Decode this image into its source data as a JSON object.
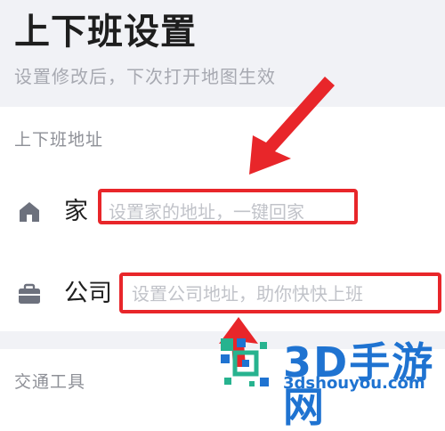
{
  "header": {
    "title": "上下班设置",
    "subtitle": "设置修改后，下次打开地图生效"
  },
  "sections": {
    "commute_label": "上下班地址",
    "transport_label": "交通工具"
  },
  "rows": {
    "home": {
      "label": "家",
      "placeholder": "设置家的地址，一键回家",
      "icon": "home-icon"
    },
    "company": {
      "label": "公司",
      "placeholder": "设置公司地址，助你快快上班",
      "icon": "briefcase-icon"
    }
  },
  "watermark": {
    "brand": "3D手游网",
    "url": "3dshouyou.com"
  },
  "colors": {
    "background": "#ffffff",
    "header_background": "#f1f2f6",
    "annotation_red": "#e8262a",
    "placeholder": "#c1c3c9",
    "icon_gray": "#6d717d",
    "watermark_blue": "#1f73d1",
    "watermark_green": "#27b38f"
  }
}
